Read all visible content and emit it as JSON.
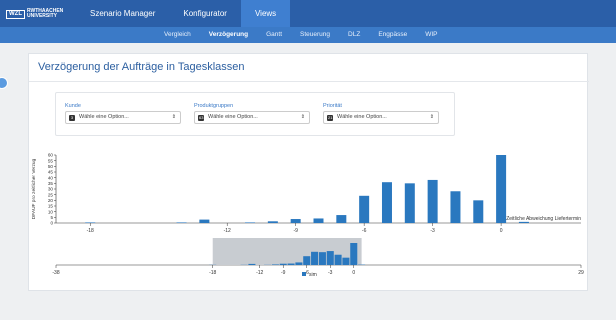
{
  "topnav": {
    "logo_box": "WZL",
    "logo_text": "RWTHAACHEN UNIVERSITY",
    "items": [
      "Szenario Manager",
      "Konfigurator",
      "Views"
    ],
    "active": "Views"
  },
  "subnav": {
    "items": [
      "Vergleich",
      "Verzögerung",
      "Gantt",
      "Steuerung",
      "DLZ",
      "Engpässe",
      "WIP"
    ],
    "active": "Verzögerung"
  },
  "page": {
    "title": "Verzögerung der Aufträge in Tagesklassen"
  },
  "filters": [
    {
      "label": "Kunde",
      "badge": "3",
      "placeholder": "Wähle eine Option..."
    },
    {
      "label": "Produktgruppen",
      "badge": "63",
      "placeholder": "Wähle eine Option..."
    },
    {
      "label": "Priorität",
      "badge": "21",
      "placeholder": "Wähle eine Option..."
    }
  ],
  "colors": {
    "accent": "#2b5fa8",
    "bar": "#2a78bf"
  },
  "chart_data": {
    "type": "bar",
    "ylabel": "DFAUF pro zeitlicher Verzug",
    "xlabel": "Zeitliche Abweichung Liefertermin",
    "ylim": [
      0,
      60
    ],
    "yticks": [
      0,
      5,
      10,
      15,
      20,
      25,
      30,
      35,
      40,
      45,
      50,
      55,
      60
    ],
    "xticks": [
      -18,
      -12,
      -9,
      -6,
      -3,
      0
    ],
    "x": [
      -18,
      -14,
      -13,
      -11,
      -10,
      -9,
      -8,
      -7,
      -6,
      -5,
      -4,
      -3,
      -2,
      -1,
      0,
      1
    ],
    "values": [
      0.5,
      0.5,
      3,
      0.5,
      1.5,
      3.5,
      4,
      7,
      24,
      36,
      35,
      38,
      28,
      20,
      60,
      1
    ],
    "legend": [
      "sim"
    ],
    "navigator": {
      "xticks": [
        -38,
        -18,
        -12,
        -9,
        -6,
        -3,
        0,
        29
      ],
      "tick_labels": [
        "-38",
        "-18",
        "-12",
        "-9",
        "-6",
        "-3",
        "0",
        "29"
      ],
      "range": [
        -38,
        29
      ],
      "selected": [
        -18,
        1
      ]
    }
  }
}
